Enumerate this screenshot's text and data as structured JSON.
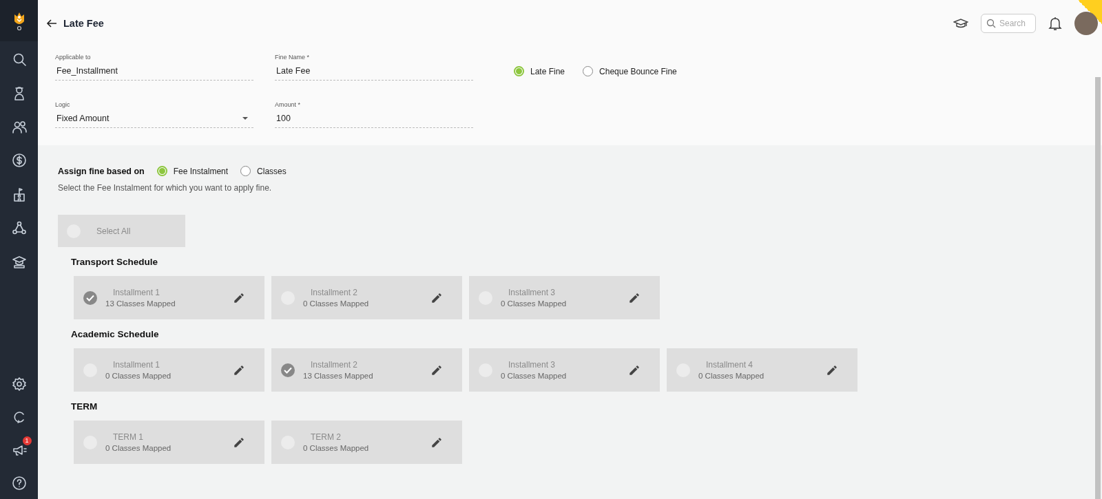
{
  "sidebar": {
    "badge": "1"
  },
  "header": {
    "title": "Late Fee",
    "search": {
      "placeholder": "Search"
    }
  },
  "form": {
    "fields": [
      {
        "label": "Applicable to",
        "value": "Fee_Installment",
        "kind": "text"
      },
      {
        "label": "Fine Name *",
        "value": "Late Fee",
        "kind": "text"
      },
      {
        "label": "Logic",
        "value": "Fixed Amount",
        "kind": "dropdown"
      },
      {
        "label": "Amount *",
        "value": "100",
        "kind": "text"
      }
    ],
    "fine_type": [
      {
        "label": "Late Fine",
        "selected": true
      },
      {
        "label": "Cheque Bounce Fine",
        "selected": false
      }
    ]
  },
  "assign": {
    "label": "Assign fine based on",
    "options": [
      {
        "label": "Fee Instalment",
        "selected": true
      },
      {
        "label": "Classes",
        "selected": false
      }
    ],
    "hint": "Select the Fee Instalment for which you want to apply fine."
  },
  "select_all": {
    "label": "Select All",
    "checked": false
  },
  "schedules": [
    {
      "title": "Transport Schedule",
      "items": [
        {
          "title": "Installment 1",
          "subtitle": "13 Classes Mapped",
          "checked": true
        },
        {
          "title": "Installment 2",
          "subtitle": "0 Classes Mapped",
          "checked": false
        },
        {
          "title": "Installment 3",
          "subtitle": "0 Classes Mapped",
          "checked": false
        }
      ]
    },
    {
      "title": "Academic Schedule",
      "items": [
        {
          "title": "Installment 1",
          "subtitle": "0 Classes Mapped",
          "checked": false
        },
        {
          "title": "Installment 2",
          "subtitle": "13 Classes Mapped",
          "checked": true
        },
        {
          "title": "Installment 3",
          "subtitle": "0 Classes Mapped",
          "checked": false
        },
        {
          "title": "Installment 4",
          "subtitle": "0 Classes Mapped",
          "checked": false
        }
      ]
    },
    {
      "title": "TERM",
      "items": [
        {
          "title": "TERM 1",
          "subtitle": "0 Classes Mapped",
          "checked": false
        },
        {
          "title": "TERM 2",
          "subtitle": "0 Classes Mapped",
          "checked": false
        }
      ]
    }
  ]
}
